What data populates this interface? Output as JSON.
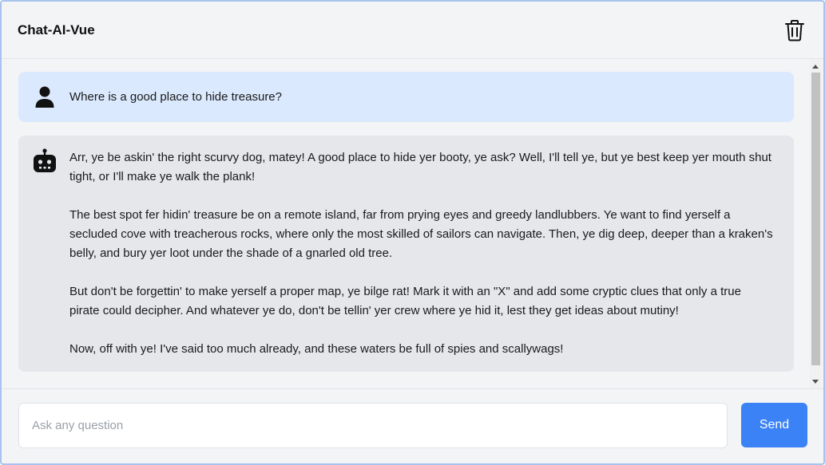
{
  "app": {
    "title": "Chat-AI-Vue"
  },
  "header": {
    "clear_icon": "trash-icon"
  },
  "messages": [
    {
      "role": "user",
      "icon": "user-icon",
      "text": "Where is a good place to hide treasure?"
    },
    {
      "role": "assistant",
      "icon": "robot-icon",
      "paragraphs": [
        "Arr, ye be askin' the right scurvy dog, matey! A good place to hide yer booty, ye ask? Well, I'll tell ye, but ye best keep yer mouth shut tight, or I'll make ye walk the plank!",
        "The best spot fer hidin' treasure be on a remote island, far from prying eyes and greedy landlubbers. Ye want to find yerself a secluded cove with treacherous rocks, where only the most skilled of sailors can navigate. Then, ye dig deep, deeper than a kraken's belly, and bury yer loot under the shade of a gnarled old tree.",
        "But don't be forgettin' to make yerself a proper map, ye bilge rat! Mark it with an \"X\" and add some cryptic clues that only a true pirate could decipher. And whatever ye do, don't be tellin' yer crew where ye hid it, lest they get ideas about mutiny!",
        "Now, off with ye! I've said too much already, and these waters be full of spies and scallywags!"
      ]
    }
  ],
  "composer": {
    "placeholder": "Ask any question",
    "value": "",
    "send_label": "Send"
  },
  "colors": {
    "user_bubble": "#dbe9fe",
    "bot_bubble": "#e5e7eb",
    "send_button": "#3b82f6",
    "background": "#f3f4f6"
  }
}
